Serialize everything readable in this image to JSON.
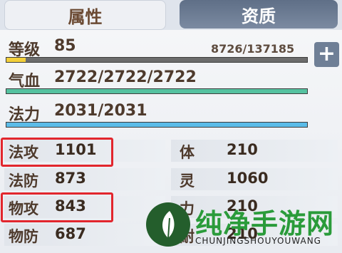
{
  "tabs": [
    {
      "label": "属性",
      "active": true
    },
    {
      "label": "资质",
      "active": false
    }
  ],
  "level": {
    "label": "等级",
    "value": "85",
    "exp": "8726/137185",
    "exp_fraction": 0.064,
    "bar_color": "#f3cf3a"
  },
  "hp": {
    "label": "气血",
    "value": "2722/2722/2722",
    "fraction": 1.0,
    "bar_color": "#55c2a0"
  },
  "mp": {
    "label": "法力",
    "value": "2031/2031",
    "fraction": 1.0,
    "bar_color": "#5bbce8"
  },
  "plus_button": {
    "icon": "plus-icon",
    "glyph": "+"
  },
  "stats_left": [
    {
      "name": "法攻",
      "value": "1101",
      "highlighted": true
    },
    {
      "name": "法防",
      "value": "873",
      "highlighted": false
    },
    {
      "name": "物攻",
      "value": "843",
      "highlighted": true
    },
    {
      "name": "物防",
      "value": "687",
      "highlighted": false
    }
  ],
  "stats_right": [
    {
      "name": "体",
      "value": "210"
    },
    {
      "name": "灵",
      "value": "1060"
    },
    {
      "name": "力",
      "value": "210"
    },
    {
      "name": "耐",
      "value": "210"
    }
  ],
  "watermark": {
    "text": "纯净手游网",
    "sub": "CHUNJINGSHOUYOUWANG",
    "logo_icon": "leaf-logo-icon"
  },
  "colors": {
    "highlight": "#e2262d",
    "tab_active_text": "#6b4a33",
    "tab_inactive_bg": "#6f7f96"
  }
}
